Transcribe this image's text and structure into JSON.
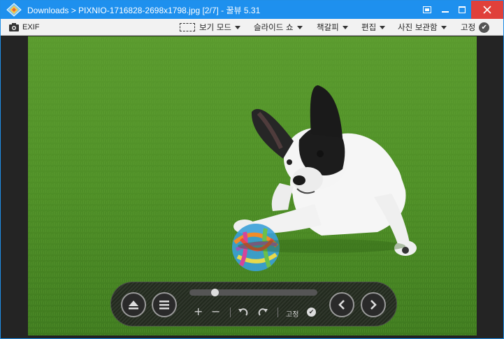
{
  "window": {
    "title": "Downloads > PIXNIO-1716828-2698x1798.jpg [2/7] - 꿀뷰 5.31"
  },
  "toolbar": {
    "exif_label": "EXIF",
    "view_mode": "보기 모드",
    "slideshow": "슬라이드 쇼",
    "bookmark": "책갈피",
    "edit": "편집",
    "photo_storage": "사진 보관함",
    "pin": "고정"
  },
  "controls": {
    "pin_label": "고정",
    "zoom_in": "+",
    "zoom_out": "−",
    "slider_position": 0.18
  },
  "colors": {
    "titlebar": "#1e90ee",
    "close": "#e0403a",
    "grass": "#4f8f2a"
  }
}
